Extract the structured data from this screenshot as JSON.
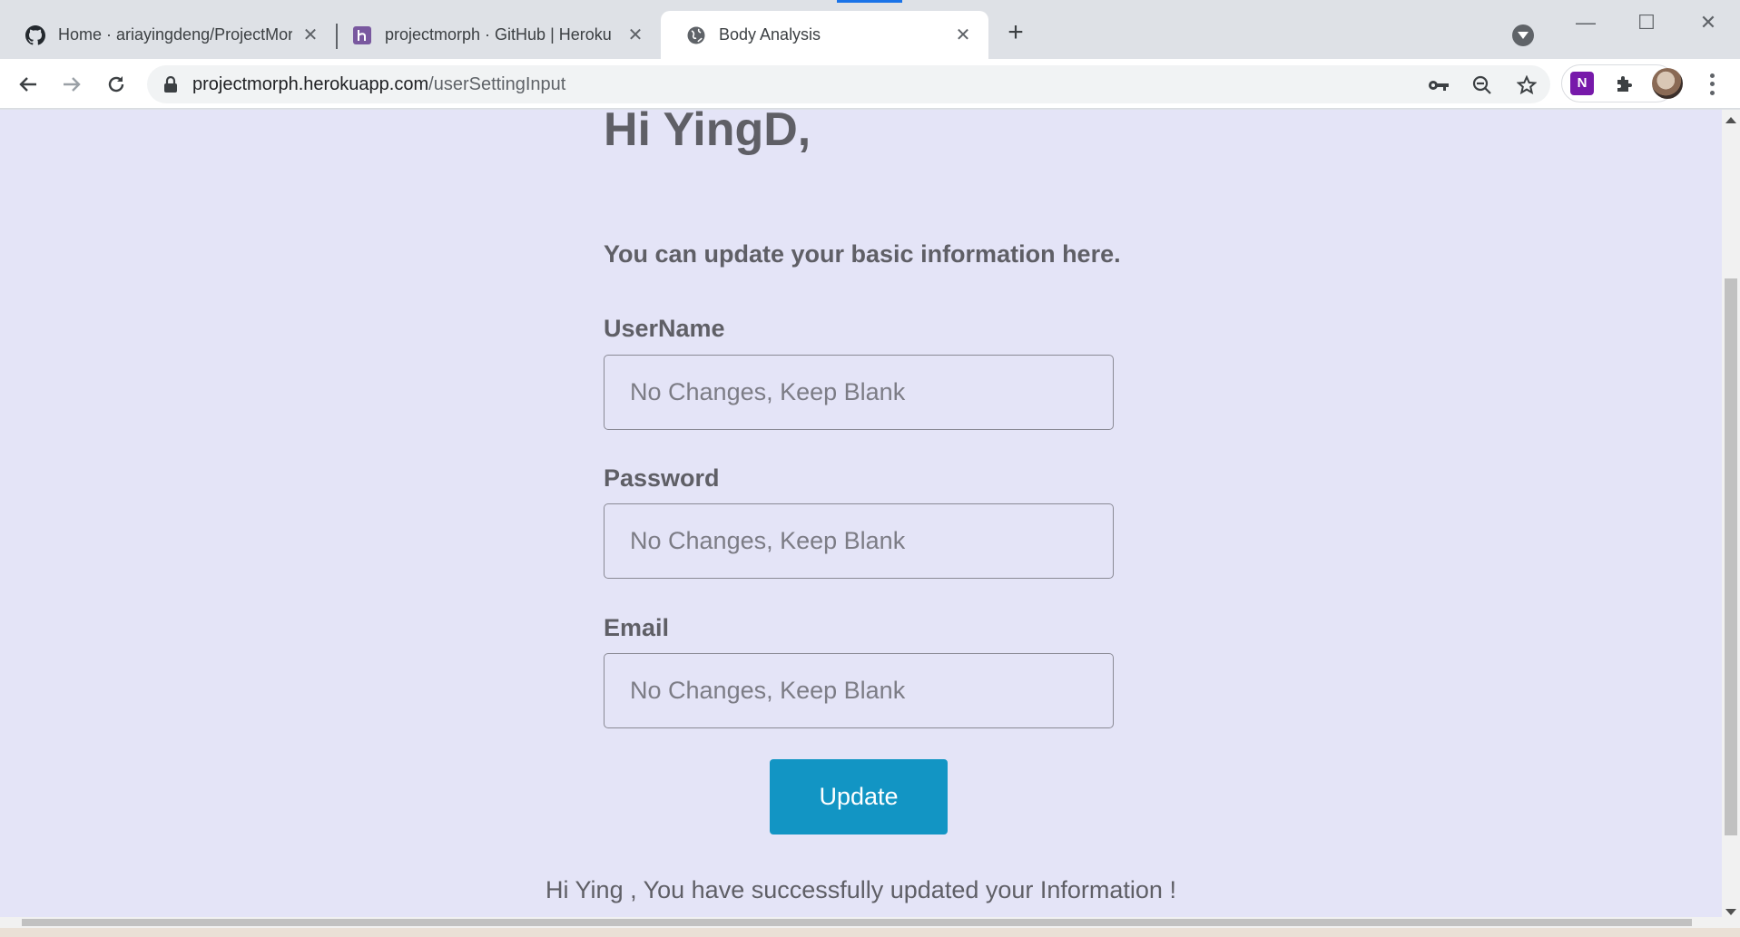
{
  "browser": {
    "tabs": [
      {
        "title": "Home · ariayingdeng/ProjectMorph",
        "icon": "github-icon",
        "active": false
      },
      {
        "title": "projectmorph · GitHub | Heroku",
        "icon": "heroku-icon",
        "active": false
      },
      {
        "title": "Body Analysis",
        "icon": "globe-icon",
        "active": true
      }
    ],
    "url_domain": "projectmorph.herokuapp.com",
    "url_path": "/userSettingInput",
    "colors": {
      "accent": "#1a73e8",
      "tabstrip": "#dee1e6"
    }
  },
  "page": {
    "greeting": "Hi YingD,",
    "subtitle": "You can update your basic information here.",
    "fields": [
      {
        "label": "UserName",
        "placeholder": "No Changes, Keep Blank"
      },
      {
        "label": "Password",
        "placeholder": "No Changes, Keep Blank"
      },
      {
        "label": "Email",
        "placeholder": "No Changes, Keep Blank"
      }
    ],
    "update_button": "Update",
    "success_message": "Hi Ying , You have successfully updated your Information !",
    "colors": {
      "background": "#e4e4f7",
      "button": "#1295c4",
      "text": "#5f5f66"
    }
  }
}
